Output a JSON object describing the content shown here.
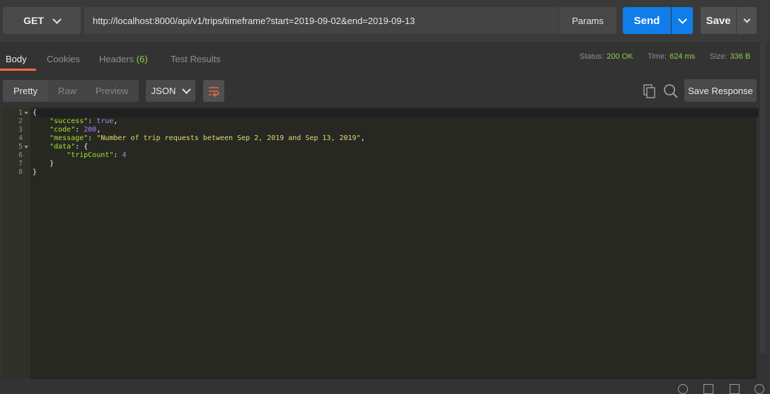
{
  "request": {
    "method": "GET",
    "url": "http://localhost:8000/api/v1/trips/timeframe?start=2019-09-02&end=2019-09-13",
    "params_label": "Params",
    "send_label": "Send",
    "save_label": "Save"
  },
  "response_tabs": {
    "body": "Body",
    "cookies": "Cookies",
    "headers": "Headers",
    "headers_count": "(6)",
    "test_results": "Test Results"
  },
  "response_meta": {
    "status_label": "Status:",
    "status_value": "200 OK",
    "time_label": "Time:",
    "time_value": "624 ms",
    "size_label": "Size:",
    "size_value": "336 B"
  },
  "body_toolbar": {
    "pretty": "Pretty",
    "raw": "Raw",
    "preview": "Preview",
    "format": "JSON",
    "save_response": "Save Response"
  },
  "code": {
    "line_numbers": [
      "1",
      "2",
      "3",
      "4",
      "5",
      "6",
      "7",
      "8"
    ],
    "open_brace": "{",
    "success_key": "\"success\"",
    "success_value": "true",
    "code_key": "\"code\"",
    "code_value": "200",
    "message_key": "\"message\"",
    "message_value": "\"Number of trip requests between Sep 2, 2019 and Sep 13, 2019\"",
    "data_key": "\"data\"",
    "tripcount_key": "\"tripCount\"",
    "tripcount_value": "4",
    "inner_close": "}",
    "close_brace": "}"
  },
  "colors": {
    "send_button": "#107dea",
    "status_ok": "#8fd043",
    "active_tab_underline": "#f26b3a",
    "editor_bg": "#272822"
  }
}
